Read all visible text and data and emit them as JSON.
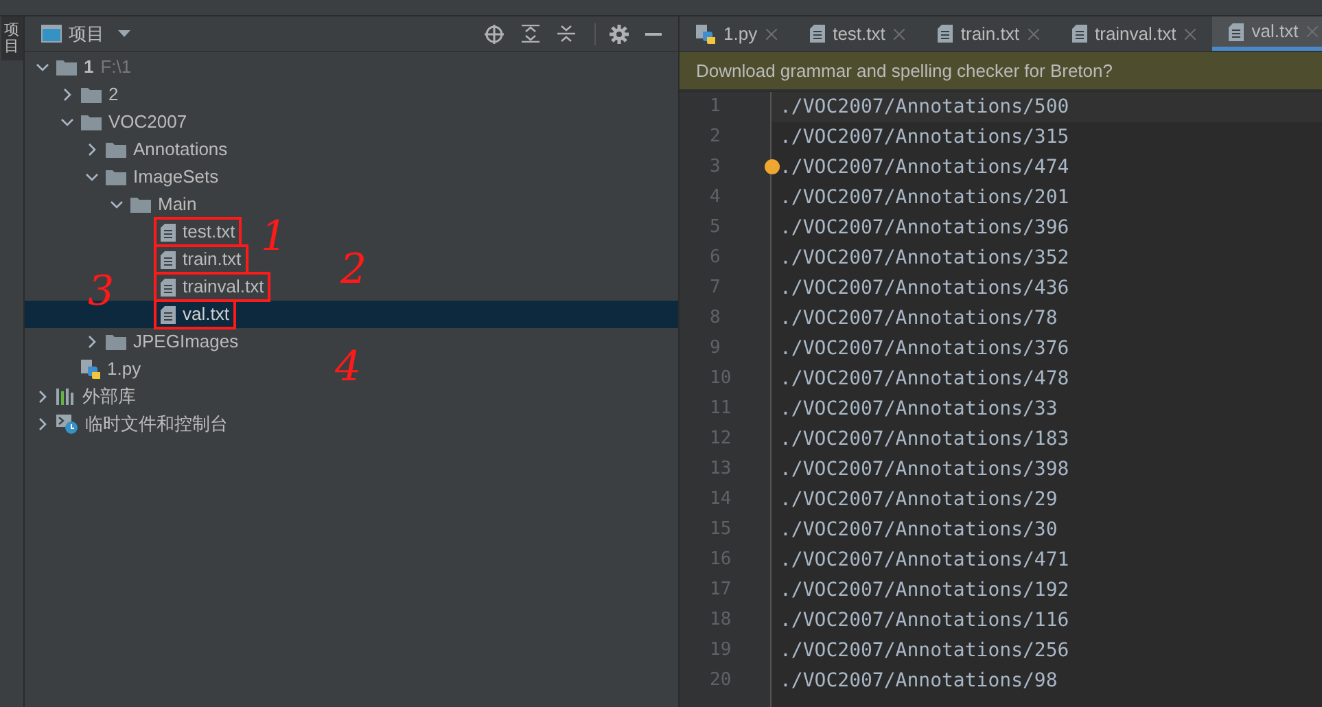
{
  "side_strip": {
    "tab": "项目"
  },
  "project_panel": {
    "title": "项目",
    "tree": [
      {
        "name": "1",
        "hint": "F:\\1",
        "kind": "folder",
        "expanded": true,
        "selected": false,
        "marked": false,
        "children": [
          {
            "name": "2",
            "kind": "folder",
            "expanded": false,
            "selected": false,
            "marked": false
          },
          {
            "name": "VOC2007",
            "kind": "folder",
            "expanded": true,
            "selected": false,
            "marked": false,
            "children": [
              {
                "name": "Annotations",
                "kind": "folder",
                "expanded": false,
                "selected": false,
                "marked": false
              },
              {
                "name": "ImageSets",
                "kind": "folder",
                "expanded": true,
                "selected": false,
                "marked": false,
                "children": [
                  {
                    "name": "Main",
                    "kind": "folder",
                    "expanded": true,
                    "selected": false,
                    "marked": false,
                    "children": [
                      {
                        "name": "test.txt",
                        "kind": "text",
                        "selected": false,
                        "marked": true
                      },
                      {
                        "name": "train.txt",
                        "kind": "text",
                        "selected": false,
                        "marked": true
                      },
                      {
                        "name": "trainval.txt",
                        "kind": "text",
                        "selected": false,
                        "marked": true
                      },
                      {
                        "name": "val.txt",
                        "kind": "text",
                        "selected": true,
                        "marked": true
                      }
                    ]
                  }
                ]
              },
              {
                "name": "JPEGImages",
                "kind": "folder",
                "expanded": false,
                "selected": false,
                "marked": false
              }
            ]
          },
          {
            "name": "1.py",
            "kind": "python",
            "selected": false,
            "marked": false
          }
        ]
      },
      {
        "name": "外部库",
        "kind": "library",
        "expanded": false,
        "selected": false,
        "marked": false
      },
      {
        "name": "临时文件和控制台",
        "kind": "scratch",
        "expanded": false,
        "selected": false,
        "marked": false
      }
    ],
    "annotations": [
      "1",
      "2",
      "3",
      "4"
    ]
  },
  "editor": {
    "tabs": [
      {
        "label": "1.py",
        "kind": "python",
        "selected": false
      },
      {
        "label": "test.txt",
        "kind": "text",
        "selected": false
      },
      {
        "label": "train.txt",
        "kind": "text",
        "selected": false
      },
      {
        "label": "trainval.txt",
        "kind": "text",
        "selected": false
      },
      {
        "label": "val.txt",
        "kind": "text",
        "selected": true
      }
    ],
    "banner": "Download grammar and spelling checker for Breton?",
    "lines": [
      {
        "number": "1",
        "text": "./VOC2007/Annotations/500"
      },
      {
        "number": "2",
        "text": "./VOC2007/Annotations/315"
      },
      {
        "number": "3",
        "text": "./VOC2007/Annotations/474"
      },
      {
        "number": "4",
        "text": "./VOC2007/Annotations/201"
      },
      {
        "number": "5",
        "text": "./VOC2007/Annotations/396"
      },
      {
        "number": "6",
        "text": "./VOC2007/Annotations/352"
      },
      {
        "number": "7",
        "text": "./VOC2007/Annotations/436"
      },
      {
        "number": "8",
        "text": "./VOC2007/Annotations/78"
      },
      {
        "number": "9",
        "text": "./VOC2007/Annotations/376"
      },
      {
        "number": "10",
        "text": "./VOC2007/Annotations/478"
      },
      {
        "number": "11",
        "text": "./VOC2007/Annotations/33"
      },
      {
        "number": "12",
        "text": "./VOC2007/Annotations/183"
      },
      {
        "number": "13",
        "text": "./VOC2007/Annotations/398"
      },
      {
        "number": "14",
        "text": "./VOC2007/Annotations/29"
      },
      {
        "number": "15",
        "text": "./VOC2007/Annotations/30"
      },
      {
        "number": "16",
        "text": "./VOC2007/Annotations/471"
      },
      {
        "number": "17",
        "text": "./VOC2007/Annotations/192"
      },
      {
        "number": "18",
        "text": "./VOC2007/Annotations/116"
      },
      {
        "number": "19",
        "text": "./VOC2007/Annotations/256"
      },
      {
        "number": "20",
        "text": "./VOC2007/Annotations/98"
      }
    ]
  }
}
